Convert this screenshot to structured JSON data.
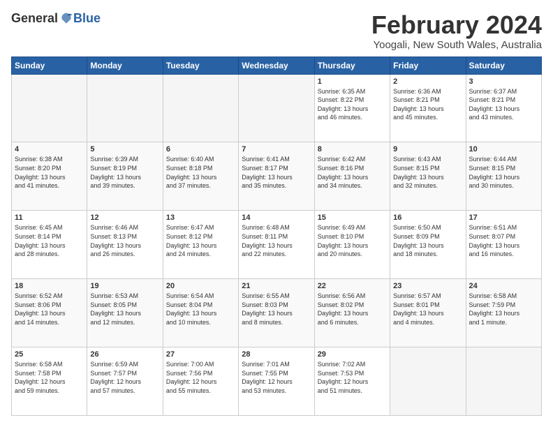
{
  "header": {
    "logo_general": "General",
    "logo_blue": "Blue",
    "month_title": "February 2024",
    "location": "Yoogali, New South Wales, Australia"
  },
  "days_of_week": [
    "Sunday",
    "Monday",
    "Tuesday",
    "Wednesday",
    "Thursday",
    "Friday",
    "Saturday"
  ],
  "weeks": [
    [
      {
        "day": "",
        "info": ""
      },
      {
        "day": "",
        "info": ""
      },
      {
        "day": "",
        "info": ""
      },
      {
        "day": "",
        "info": ""
      },
      {
        "day": "1",
        "info": "Sunrise: 6:35 AM\nSunset: 8:22 PM\nDaylight: 13 hours\nand 46 minutes."
      },
      {
        "day": "2",
        "info": "Sunrise: 6:36 AM\nSunset: 8:21 PM\nDaylight: 13 hours\nand 45 minutes."
      },
      {
        "day": "3",
        "info": "Sunrise: 6:37 AM\nSunset: 8:21 PM\nDaylight: 13 hours\nand 43 minutes."
      }
    ],
    [
      {
        "day": "4",
        "info": "Sunrise: 6:38 AM\nSunset: 8:20 PM\nDaylight: 13 hours\nand 41 minutes."
      },
      {
        "day": "5",
        "info": "Sunrise: 6:39 AM\nSunset: 8:19 PM\nDaylight: 13 hours\nand 39 minutes."
      },
      {
        "day": "6",
        "info": "Sunrise: 6:40 AM\nSunset: 8:18 PM\nDaylight: 13 hours\nand 37 minutes."
      },
      {
        "day": "7",
        "info": "Sunrise: 6:41 AM\nSunset: 8:17 PM\nDaylight: 13 hours\nand 35 minutes."
      },
      {
        "day": "8",
        "info": "Sunrise: 6:42 AM\nSunset: 8:16 PM\nDaylight: 13 hours\nand 34 minutes."
      },
      {
        "day": "9",
        "info": "Sunrise: 6:43 AM\nSunset: 8:15 PM\nDaylight: 13 hours\nand 32 minutes."
      },
      {
        "day": "10",
        "info": "Sunrise: 6:44 AM\nSunset: 8:15 PM\nDaylight: 13 hours\nand 30 minutes."
      }
    ],
    [
      {
        "day": "11",
        "info": "Sunrise: 6:45 AM\nSunset: 8:14 PM\nDaylight: 13 hours\nand 28 minutes."
      },
      {
        "day": "12",
        "info": "Sunrise: 6:46 AM\nSunset: 8:13 PM\nDaylight: 13 hours\nand 26 minutes."
      },
      {
        "day": "13",
        "info": "Sunrise: 6:47 AM\nSunset: 8:12 PM\nDaylight: 13 hours\nand 24 minutes."
      },
      {
        "day": "14",
        "info": "Sunrise: 6:48 AM\nSunset: 8:11 PM\nDaylight: 13 hours\nand 22 minutes."
      },
      {
        "day": "15",
        "info": "Sunrise: 6:49 AM\nSunset: 8:10 PM\nDaylight: 13 hours\nand 20 minutes."
      },
      {
        "day": "16",
        "info": "Sunrise: 6:50 AM\nSunset: 8:09 PM\nDaylight: 13 hours\nand 18 minutes."
      },
      {
        "day": "17",
        "info": "Sunrise: 6:51 AM\nSunset: 8:07 PM\nDaylight: 13 hours\nand 16 minutes."
      }
    ],
    [
      {
        "day": "18",
        "info": "Sunrise: 6:52 AM\nSunset: 8:06 PM\nDaylight: 13 hours\nand 14 minutes."
      },
      {
        "day": "19",
        "info": "Sunrise: 6:53 AM\nSunset: 8:05 PM\nDaylight: 13 hours\nand 12 minutes."
      },
      {
        "day": "20",
        "info": "Sunrise: 6:54 AM\nSunset: 8:04 PM\nDaylight: 13 hours\nand 10 minutes."
      },
      {
        "day": "21",
        "info": "Sunrise: 6:55 AM\nSunset: 8:03 PM\nDaylight: 13 hours\nand 8 minutes."
      },
      {
        "day": "22",
        "info": "Sunrise: 6:56 AM\nSunset: 8:02 PM\nDaylight: 13 hours\nand 6 minutes."
      },
      {
        "day": "23",
        "info": "Sunrise: 6:57 AM\nSunset: 8:01 PM\nDaylight: 13 hours\nand 4 minutes."
      },
      {
        "day": "24",
        "info": "Sunrise: 6:58 AM\nSunset: 7:59 PM\nDaylight: 13 hours\nand 1 minute."
      }
    ],
    [
      {
        "day": "25",
        "info": "Sunrise: 6:58 AM\nSunset: 7:58 PM\nDaylight: 12 hours\nand 59 minutes."
      },
      {
        "day": "26",
        "info": "Sunrise: 6:59 AM\nSunset: 7:57 PM\nDaylight: 12 hours\nand 57 minutes."
      },
      {
        "day": "27",
        "info": "Sunrise: 7:00 AM\nSunset: 7:56 PM\nDaylight: 12 hours\nand 55 minutes."
      },
      {
        "day": "28",
        "info": "Sunrise: 7:01 AM\nSunset: 7:55 PM\nDaylight: 12 hours\nand 53 minutes."
      },
      {
        "day": "29",
        "info": "Sunrise: 7:02 AM\nSunset: 7:53 PM\nDaylight: 12 hours\nand 51 minutes."
      },
      {
        "day": "",
        "info": ""
      },
      {
        "day": "",
        "info": ""
      }
    ]
  ]
}
